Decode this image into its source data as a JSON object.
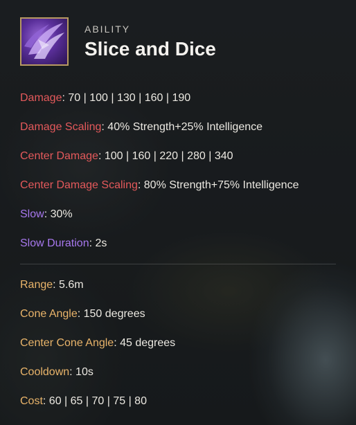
{
  "ability": {
    "kicker": "ABILITY",
    "name": "Slice and Dice",
    "icon": "slashing-claw-icon"
  },
  "damage_stats": [
    {
      "label": "Damage",
      "value": "70 | 100 | 130 | 160 | 190"
    },
    {
      "label": "Damage Scaling",
      "value": "40% Strength+25% Intelligence"
    },
    {
      "label": "Center Damage",
      "value": "100 | 160 | 220 | 280 | 340"
    },
    {
      "label": "Center Damage Scaling",
      "value": "80% Strength+75% Intelligence"
    }
  ],
  "effect_stats": [
    {
      "label": "Slow",
      "value": "30%"
    },
    {
      "label": "Slow Duration",
      "value": "2s"
    }
  ],
  "general_stats": [
    {
      "label": "Range",
      "value": "5.6m"
    },
    {
      "label": "Cone Angle",
      "value": "150 degrees"
    },
    {
      "label": "Center Cone Angle",
      "value": "45 degrees"
    },
    {
      "label": "Cooldown",
      "value": "10s"
    },
    {
      "label": "Cost",
      "value": "60 | 65 | 70 | 75 | 80"
    }
  ],
  "colors": {
    "damage_label": "#e4595b",
    "effect_label": "#a778ee",
    "general_label": "#e9b46a",
    "icon_border": "#b89a62"
  }
}
